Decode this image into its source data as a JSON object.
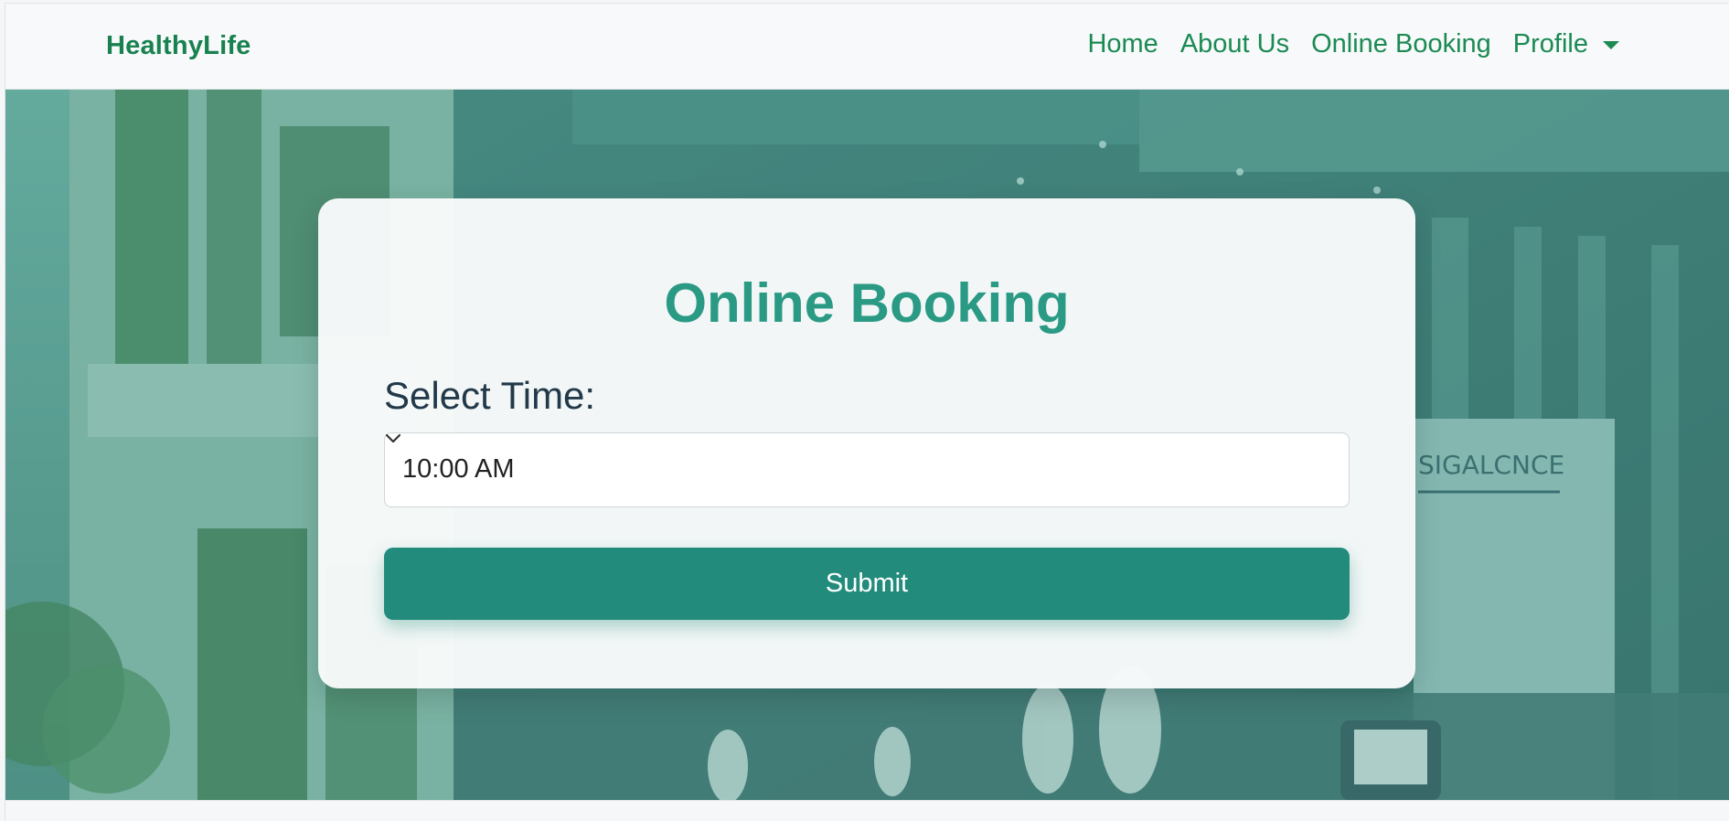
{
  "navbar": {
    "brand": "HealthyLife",
    "links": [
      {
        "label": "Home"
      },
      {
        "label": "About Us"
      },
      {
        "label": "Online Booking"
      },
      {
        "label": "Profile"
      }
    ]
  },
  "booking": {
    "title": "Online Booking",
    "time_label": "Select Time:",
    "selected_time": "10:00 AM",
    "submit_label": "Submit"
  },
  "colors": {
    "brand_green": "#19814f",
    "title_teal": "#2a9a85",
    "button_teal": "#228b7c",
    "hero_overlay": "#4f9a8c"
  },
  "icons": {
    "select_arrow": "chevron-down-icon",
    "profile_dropdown": "caret-down-icon"
  },
  "hero_image": {
    "sign_text": "SIGALCNCE"
  }
}
